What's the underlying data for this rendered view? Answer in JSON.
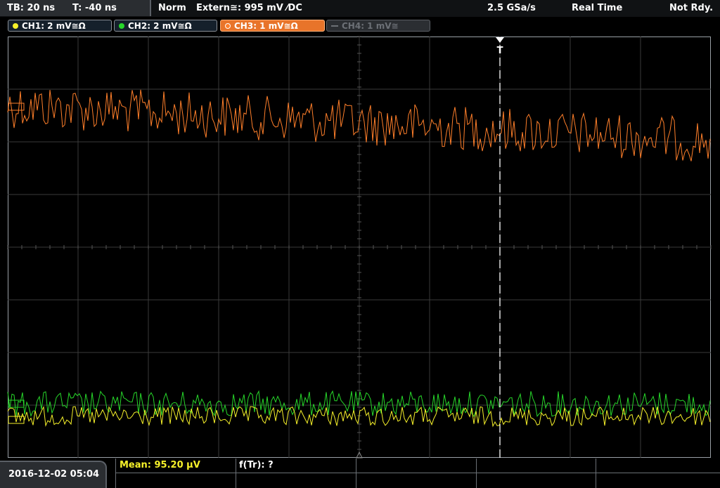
{
  "header": {
    "timebase": "TB: 20 ns",
    "trigger_time": "T: -40 ns",
    "mode": "Norm",
    "trigger_source": "Extern≅: 995 mV ⁄DC",
    "sample_rate": "2.5 GSa/s",
    "acq_mode": "Real Time",
    "status": "Not Rdy."
  },
  "channels": [
    {
      "label": "CH1: 2 mV≅Ω",
      "color": "#f6f12a",
      "state": "on"
    },
    {
      "label": "CH2: 2 mV≅Ω",
      "color": "#27d72a",
      "state": "on"
    },
    {
      "label": "CH3: 1 mV≅Ω",
      "color": "#ff7f2a",
      "state": "active"
    },
    {
      "label": "CH4: 1 mV≅",
      "color": "#6c7076",
      "state": "off"
    }
  ],
  "footer": {
    "datetime": "2016-12-02 05:04",
    "measure1": "Mean: 95.20 µV",
    "measure2": "f(Tr): ?"
  },
  "icons": {
    "trigger_marker": "trigger-arrow-icon",
    "trigger_label": "T"
  },
  "colors": {
    "ch1": "#f6f12a",
    "ch2": "#27d72a",
    "ch3": "#ff7f2a",
    "grid": "#3a3a3a",
    "trigger_line": "#ffffff",
    "panel": "#2a2d31"
  }
}
